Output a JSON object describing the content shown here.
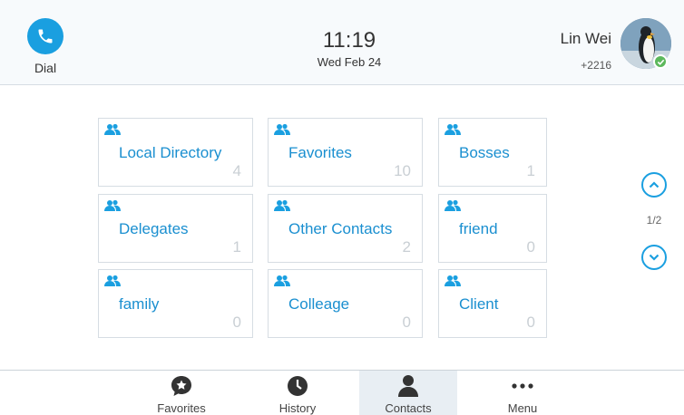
{
  "header": {
    "dial_label": "Dial",
    "time": "11:19",
    "date": "Wed Feb 24",
    "user_name": "Lin Wei",
    "user_extension": "+2216",
    "presence_status": "available"
  },
  "contacts": {
    "groups": [
      {
        "label": "Local Directory",
        "count": "4"
      },
      {
        "label": "Favorites",
        "count": "10"
      },
      {
        "label": "Bosses",
        "count": "1"
      },
      {
        "label": "Delegates",
        "count": "1"
      },
      {
        "label": "Other Contacts",
        "count": "2"
      },
      {
        "label": "friend",
        "count": "0"
      },
      {
        "label": "family",
        "count": "0"
      },
      {
        "label": "Colleage",
        "count": "0"
      },
      {
        "label": "Client",
        "count": "0"
      }
    ],
    "page_indicator": "1/2"
  },
  "tabs": [
    {
      "label": "Favorites",
      "icon": "star-bubble-icon",
      "active": false
    },
    {
      "label": "History",
      "icon": "clock-icon",
      "active": false
    },
    {
      "label": "Contacts",
      "icon": "person-icon",
      "active": true
    },
    {
      "label": "Menu",
      "icon": "ellipsis-icon",
      "active": false
    }
  ],
  "colors": {
    "accent": "#1a9fe0",
    "tile_label": "#1a8fd0",
    "presence": "#5cb85c",
    "active_tab_bg": "#e8eef3"
  }
}
